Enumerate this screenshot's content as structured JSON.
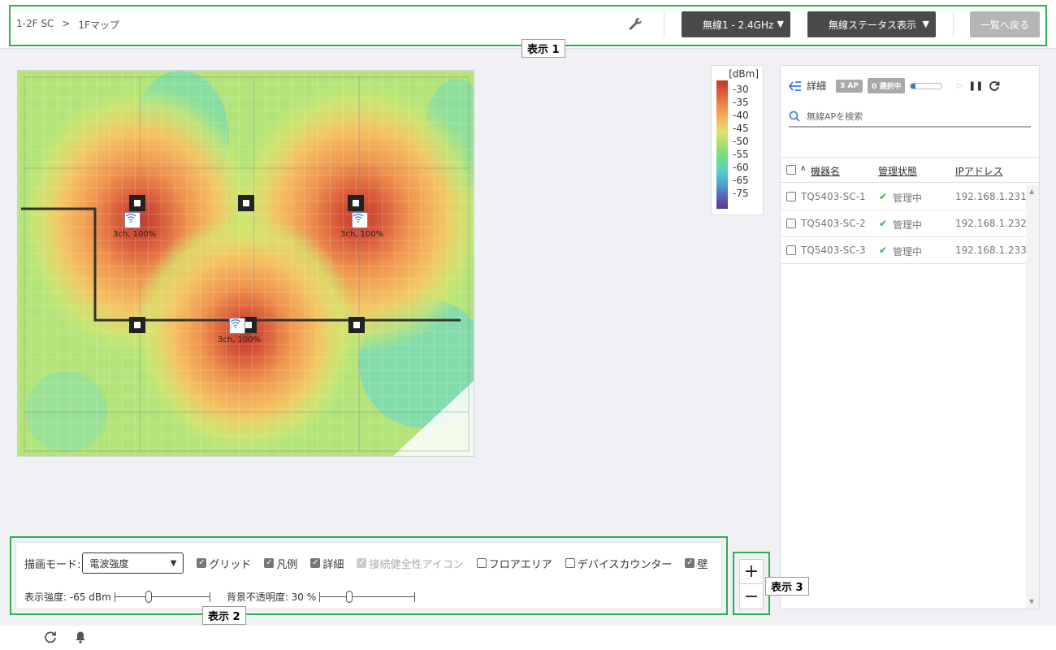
{
  "breadcrumb": [
    "1-2F SC",
    ">",
    "1Fマップ"
  ],
  "header": {
    "band_select": "無線1 - 2.4GHz",
    "status_select": "無線ステータス表示",
    "back_label": "一覧へ戻る"
  },
  "callouts": {
    "c1": "表示 1",
    "c2": "表示 2",
    "c3": "表示 3"
  },
  "legend": {
    "unit": "[dBm]",
    "ticks": [
      "-30",
      "-35",
      "-40",
      "-45",
      "-50",
      "-55",
      "-60",
      "-65",
      "-75"
    ]
  },
  "map": {
    "aps": [
      {
        "label": "3ch, 100%"
      },
      {
        "label": "3ch, 100%"
      },
      {
        "label": "3ch, 100%"
      }
    ]
  },
  "panel": {
    "detail_label": "詳細",
    "ap_badge": "3 AP",
    "selected_badge": "0 選択中",
    "progress_fraction": 0.15,
    "search_placeholder": "無線APを検索",
    "columns": {
      "sort": "∧",
      "name": "機器名",
      "status": "管理状態",
      "ip": "IPアドレス"
    },
    "rows": [
      {
        "name": "TQ5403-SC-1",
        "status": "管理中",
        "ip": "192.168.1.231"
      },
      {
        "name": "TQ5403-SC-2",
        "status": "管理中",
        "ip": "192.168.1.232"
      },
      {
        "name": "TQ5403-SC-3",
        "status": "管理中",
        "ip": "192.168.1.233"
      }
    ]
  },
  "controls": {
    "mode_label": "描画モード:",
    "mode_value": "電波強度",
    "checks": [
      {
        "label": "グリッド",
        "checked": true,
        "disabled": false
      },
      {
        "label": "凡例",
        "checked": true,
        "disabled": false
      },
      {
        "label": "詳細",
        "checked": true,
        "disabled": false
      },
      {
        "label": "接続健全性アイコン",
        "checked": true,
        "disabled": true
      },
      {
        "label": "フロアエリア",
        "checked": false,
        "disabled": false
      },
      {
        "label": "デバイスカウンター",
        "checked": false,
        "disabled": false
      },
      {
        "label": "壁",
        "checked": true,
        "disabled": false
      }
    ],
    "strength_label": "表示強度: -65 dBm",
    "strength_fraction": 0.35,
    "opacity_label": "背景不透明度: 30 %",
    "opacity_fraction": 0.3
  },
  "zoom": {
    "in": "+",
    "out": "−"
  },
  "colors": {
    "accent": "#3a7bd5",
    "callout": "#2fae4e",
    "ok": "#2fae4e"
  }
}
